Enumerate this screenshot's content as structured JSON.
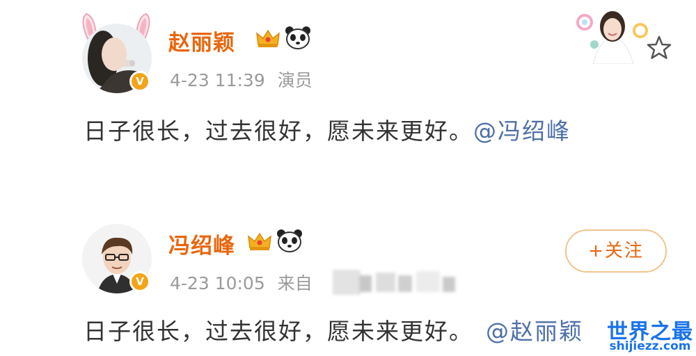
{
  "posts": [
    {
      "username": "赵丽颖",
      "time": "4-23 11:39",
      "source": "演员",
      "text": "日子很长，过去很好，愿未来更好。",
      "mention": "@冯绍峰"
    },
    {
      "username": "冯绍峰",
      "time": "4-23 10:05",
      "source": "来自",
      "text": "日子很长，过去很好，愿未来更好。",
      "mention": "@赵丽颖"
    }
  ],
  "follow_button": "+关注",
  "verified_badge": "V",
  "watermark": {
    "title": "世界之最",
    "url": "shijiezz.com"
  },
  "icons": [
    "crown-icon",
    "panda-icon",
    "star-icon",
    "verified-badge-icon",
    "bunny-ears-icon",
    "sticker-image"
  ],
  "colors": {
    "username": "#e8660d",
    "meta": "#9a9a9a",
    "mention": "#4d6fa8",
    "badge": "#f3a417",
    "follow_border": "#f1c48f",
    "watermark": "#1a73e8"
  }
}
